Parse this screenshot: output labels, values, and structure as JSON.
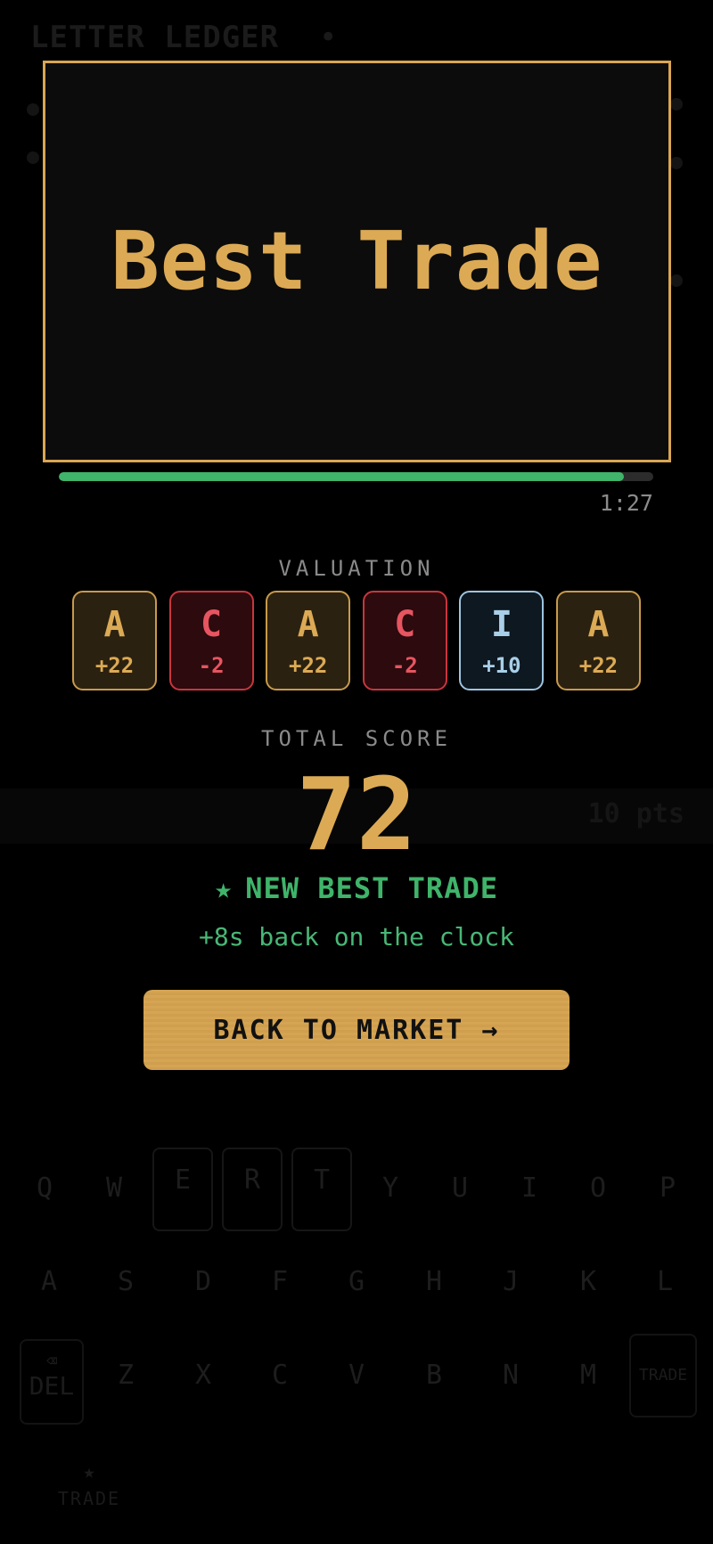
{
  "background": {
    "app_title": "LETTER LEDGER",
    "title_dot": "•",
    "best_row_points": "10 pts",
    "keyboard": {
      "row1": [
        "Q",
        "W",
        "E",
        "R",
        "T",
        "Y",
        "U",
        "I",
        "O",
        "P"
      ],
      "row2": [
        "A",
        "S",
        "D",
        "F",
        "G",
        "H",
        "J",
        "K",
        "L"
      ],
      "row3": [
        "Z",
        "X",
        "C",
        "V",
        "B",
        "N",
        "M"
      ],
      "del_label": "DEL",
      "trade_label": "TRADE"
    },
    "nav": [
      {
        "icon": "star-icon",
        "glyph": "★",
        "label": "TRADE"
      },
      {
        "icon": "chart-icon",
        "glyph": "",
        "label": ""
      },
      {
        "icon": "book-icon",
        "glyph": "",
        "label": ""
      },
      {
        "icon": "gear-icon",
        "glyph": "",
        "label": ""
      }
    ]
  },
  "modal": {
    "title": "Best Trade",
    "timer": "1:27",
    "time_progress": 0.95,
    "valuation_label": "VALUATION",
    "tiles": [
      {
        "letter": "A",
        "value": "+22",
        "kind": "gold"
      },
      {
        "letter": "C",
        "value": "-2",
        "kind": "red"
      },
      {
        "letter": "A",
        "value": "+22",
        "kind": "gold"
      },
      {
        "letter": "C",
        "value": "-2",
        "kind": "red"
      },
      {
        "letter": "I",
        "value": "+10",
        "kind": "blue"
      },
      {
        "letter": "A",
        "value": "+22",
        "kind": "gold"
      }
    ],
    "total_label": "TOTAL SCORE",
    "total_score": "72",
    "best_star": "★",
    "best_text": "NEW BEST TRADE",
    "bonus_text": "+8s back on the clock",
    "cta_label": "BACK TO MARKET →"
  },
  "colors": {
    "accent_gold": "#dcaa55",
    "positive_green": "#3fb46a",
    "negative_red": "#e65560",
    "vowel_blue": "#a9cfe8"
  }
}
